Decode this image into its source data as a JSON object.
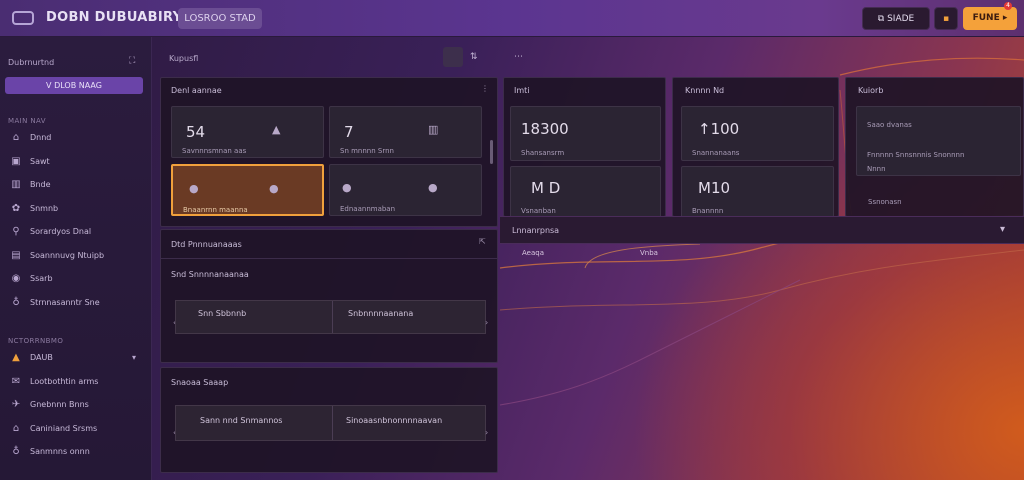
{
  "topbar": {
    "title": "DOBN DUBUABIRYNGAD",
    "env_label": "LOSROO STAD",
    "share_label": "SIADE",
    "deploy_label": "FUNE",
    "notification_count": "4"
  },
  "sidebar": {
    "header": "Dubrnurtnd",
    "header_icon": "⛶",
    "new_button": "V DLOB NAAG",
    "section_main": "MAIN NAV",
    "items_main": [
      {
        "icon": "⌂",
        "label": "Dnnd"
      },
      {
        "icon": "▣",
        "label": "Sawt"
      },
      {
        "icon": "▥",
        "label": "Bnde"
      },
      {
        "icon": "✿",
        "label": "Snmnb"
      },
      {
        "icon": "⚲",
        "label": "Sorardyos Dnal"
      },
      {
        "icon": "▤",
        "label": "Soannnuvg Ntuipb"
      },
      {
        "icon": "◉",
        "label": "Ssarb"
      },
      {
        "icon": "♁",
        "label": "Strnnasanntr Sne"
      }
    ],
    "section_secondary": "NCTORRNBMO",
    "items_secondary": [
      {
        "icon": "▲",
        "label": "DAUB",
        "chevron": "▾",
        "alert": true
      },
      {
        "icon": "✉",
        "label": "Lootbothtin arms"
      },
      {
        "icon": "✈",
        "label": "Gnebnnn Bnns"
      },
      {
        "icon": "⌂",
        "label": "Caniniand Srsms"
      },
      {
        "icon": "♁",
        "label": "Sanmnns onnn"
      }
    ]
  },
  "main": {
    "breadcrumb": "Kupusfl",
    "toolbar_icons": [
      "⇅",
      "⋯"
    ],
    "kpi_panel_title": "Denl aannae",
    "kpis": [
      {
        "value": "54",
        "icon": "▲",
        "label": "Savnnnsmnan aas"
      },
      {
        "value": "7",
        "icon": "▥",
        "label": "Sn mnnnn Srnn"
      },
      {
        "value": "",
        "icon": "●",
        "label": "Bnaanrnn maanna",
        "active": true
      },
      {
        "value": "",
        "icon": "●",
        "label": "Ednaannmaban"
      }
    ],
    "col2_title": "Imti",
    "col2_cards": [
      {
        "value": "18300",
        "label": "Shansansrm"
      },
      {
        "value": "M D",
        "label": "Vsnanban"
      }
    ],
    "col3_title": "Knnnn Nd",
    "col3_cards": [
      {
        "value": "↑100",
        "label": "Snannanaans"
      },
      {
        "value": "M10",
        "label": "Bnannnn"
      }
    ],
    "col4_title": "Kuiorb",
    "col4_lines": [
      "Saao dvanas",
      "Fnnnnn Snnsnnnis Snonnnn",
      "Nnnn",
      "Ssnonasn"
    ],
    "section_a_title": "Dtd Pnnnuanaaas",
    "section_a_sub": "Snd Snnnnanaanaa",
    "section_a_cells": [
      "Snn Sbbnnb",
      "Snbnnnnaanana"
    ],
    "section_b_title": "Snaoaa Saaap",
    "section_b_cells": [
      "Sann nnd Snmannos",
      "Sinoaasnbnonnnnaavan"
    ],
    "dropdown_label": "Lnnanrpnsa",
    "dropdown_chevron": "▾",
    "map_labels": [
      "Aeaqa",
      "Vnba"
    ]
  }
}
